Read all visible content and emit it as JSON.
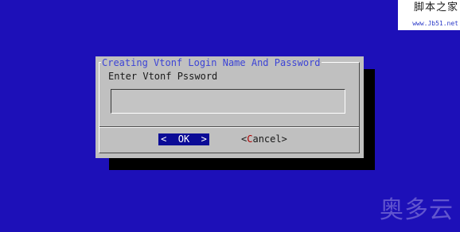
{
  "watermark": {
    "site_name": "脚本之家",
    "site_url": "www.Jb51.net",
    "bottom_brand": "奥多云"
  },
  "dialog": {
    "title": "Creating Vtonf Login Name And Password",
    "prompt": "Enter Vtonf Pssword",
    "password_value": "",
    "buttons": {
      "ok": "<  OK  >",
      "cancel_prefix": "<",
      "cancel_hotkey": "C",
      "cancel_rest": "ancel>"
    }
  },
  "colors": {
    "background": "#1d10b8",
    "dialog": "#c0c0c0",
    "title_text": "#3c43d6",
    "selected_button_bg": "#0b0b96",
    "hotkey": "#b00000"
  }
}
